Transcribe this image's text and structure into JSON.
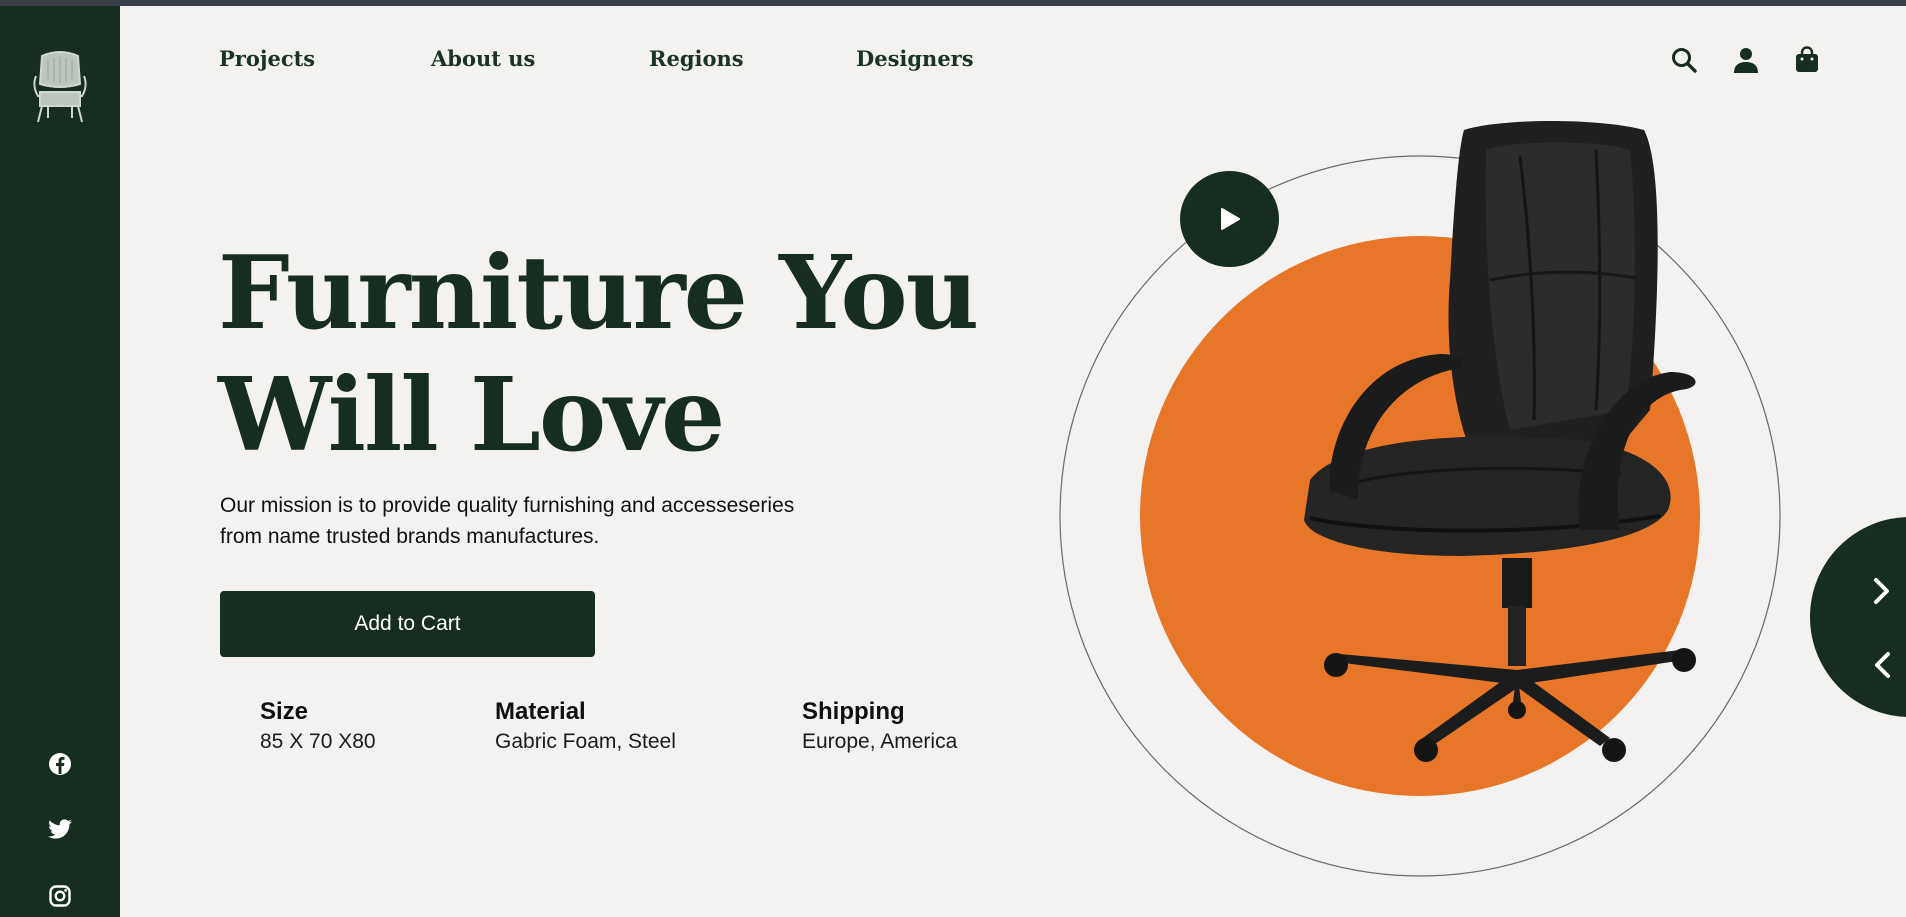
{
  "brand": {
    "logo_icon": "armchair-logo-icon"
  },
  "nav": {
    "items": [
      {
        "label": "Projects"
      },
      {
        "label": "About us"
      },
      {
        "label": "Regions"
      },
      {
        "label": "Designers"
      }
    ],
    "icons": [
      "search-icon",
      "user-icon",
      "shopping-bag-icon"
    ]
  },
  "hero": {
    "headline_line1": "Furniture You",
    "headline_line2": "Will Love",
    "mission_line1": "Our mission is to provide quality furnishing and accesseseries",
    "mission_line2": "from name trusted brands manufactures.",
    "cta_label": "Add to Cart",
    "play_icon": "play-icon"
  },
  "specs": [
    {
      "label": "Size",
      "value": "85 X 70 X80"
    },
    {
      "label": "Material",
      "value": "Gabric Foam, Steel"
    },
    {
      "label": "Shipping",
      "value": "Europe, America"
    }
  ],
  "social": [
    "facebook-icon",
    "twitter-icon",
    "instagram-icon"
  ],
  "carousel": {
    "next_icon": "chevron-right-icon",
    "prev_icon": "chevron-left-icon"
  },
  "colors": {
    "primary": "#172d1f",
    "accent": "#e87628",
    "background": "#f3f2f0"
  }
}
